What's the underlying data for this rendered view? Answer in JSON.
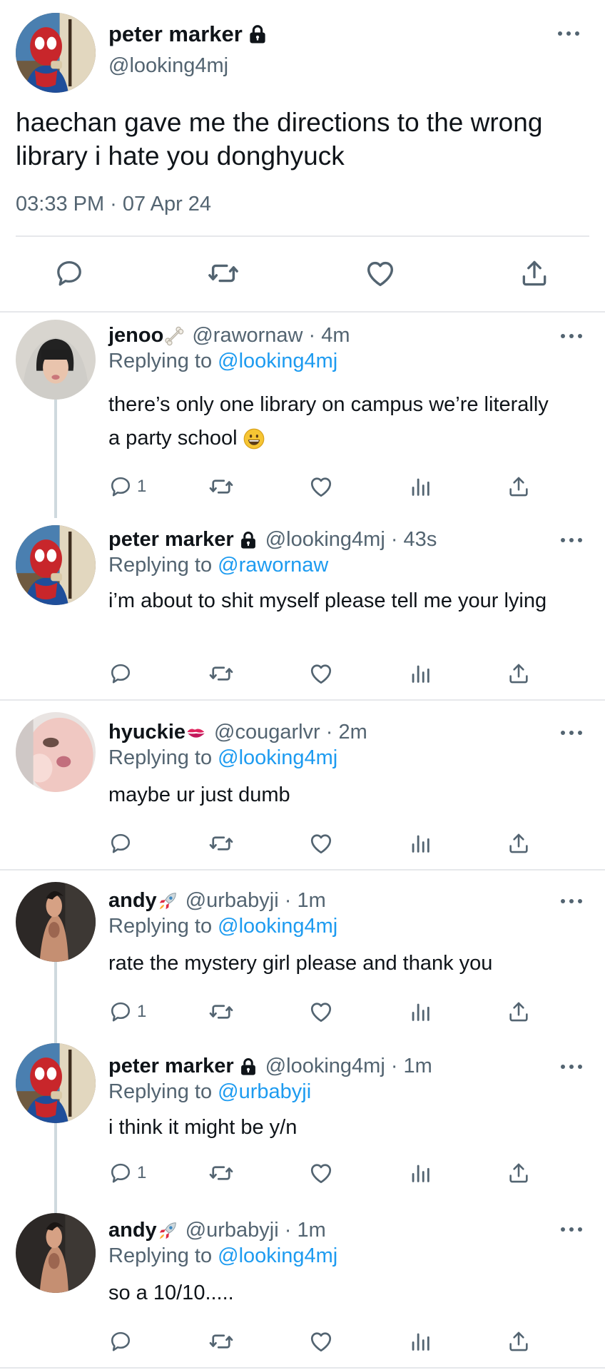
{
  "main_tweet": {
    "display_name": "peter marker",
    "handle": "@looking4mj",
    "text": "haechan gave me the directions to the wrong library i hate you donghyuck",
    "timestamp": "03:33 PM · 07 Apr 24",
    "icons": [
      "reply-icon",
      "retweet-icon",
      "like-icon",
      "share-icon"
    ]
  },
  "replies": [
    {
      "display_name": "jenoo",
      "name_icon": "bone-emoji",
      "meta": "@rawornaw · 4m",
      "replying_label": "Replying to",
      "replying_to": "@looking4mj",
      "text": "there’s only one library on campus we’re literally a party school",
      "text_emoji": "grinning-face-emoji",
      "reply_count": "1"
    },
    {
      "display_name": "peter marker",
      "name_icon": "lock-icon",
      "meta": "@looking4mj · 43s",
      "replying_label": "Replying to",
      "replying_to": "@rawornaw",
      "text": "i’m about to shit myself please tell me your lying",
      "reply_count": ""
    },
    {
      "display_name": "hyuckie",
      "name_icon": "kiss-mark-emoji",
      "meta": "@cougarlvr · 2m",
      "replying_label": "Replying to",
      "replying_to": "@looking4mj",
      "text": "maybe ur just dumb",
      "reply_count": ""
    },
    {
      "display_name": "andy",
      "name_icon": "rocket-emoji",
      "meta": "@urbabyji · 1m",
      "replying_label": "Replying to",
      "replying_to": "@looking4mj",
      "text": "rate the mystery girl please and thank you",
      "reply_count": "1"
    },
    {
      "display_name": "peter marker",
      "name_icon": "lock-icon",
      "meta": "@looking4mj · 1m",
      "replying_label": "Replying to",
      "replying_to": "@urbabyji",
      "text": "i think it might be y/n",
      "reply_count": "1"
    },
    {
      "display_name": "andy",
      "name_icon": "rocket-emoji",
      "meta": "@urbabyji · 1m",
      "replying_label": "Replying to",
      "replying_to": "@looking4mj",
      "text": "so a 10/10.....",
      "reply_count": ""
    }
  ],
  "colors": {
    "link": "#1d9bf0",
    "secondary_text": "#536471",
    "primary_text": "#0f1419",
    "divider": "#e6e8eb",
    "thread_line": "#cfd9de"
  }
}
